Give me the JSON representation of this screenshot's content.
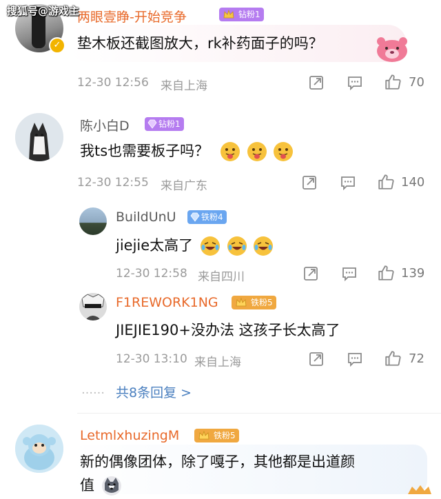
{
  "watermark": "搜狐号@游戏主",
  "comments": [
    {
      "username": "两眼壹睁-开始竞争",
      "badge": "钻粉1",
      "text": "垫木板还截图放大，rk补药面子的吗？",
      "time": "12-30 12:56",
      "location": "来自上海",
      "likes": "70"
    },
    {
      "username": "陈小白D",
      "badge": "钻粉1",
      "text": "我ts也需要板子吗？",
      "time": "12-30 12:55",
      "location": "来自广东",
      "likes": "140",
      "replies": [
        {
          "username": "BuildUnU",
          "badge": "铁粉4",
          "text": "jiejie太高了",
          "time": "12-30 12:58",
          "location": "来自四川",
          "likes": "139"
        },
        {
          "username": "F1REWORK1NG",
          "badge": "铁粉5",
          "text": "JIEJIE190+没办法 这孩子长太高了",
          "time": "12-30 13:10",
          "location": "来自上海",
          "likes": "72"
        }
      ],
      "more_replies": "共8条回复 >",
      "more_dots": "……"
    },
    {
      "username": "LetmlxhuzingM",
      "badge": "铁粉5",
      "text_line1": "新的偶像团体，除了嘎子，其他都是出道颜",
      "text_line2": "值"
    }
  ],
  "colors": {
    "orange_name": "#e8692a",
    "purple_badge": "#b57cf0",
    "blue_badge": "#6aa6f0",
    "gold_badge": "#f0a840",
    "link_blue": "#4a7fbf"
  }
}
